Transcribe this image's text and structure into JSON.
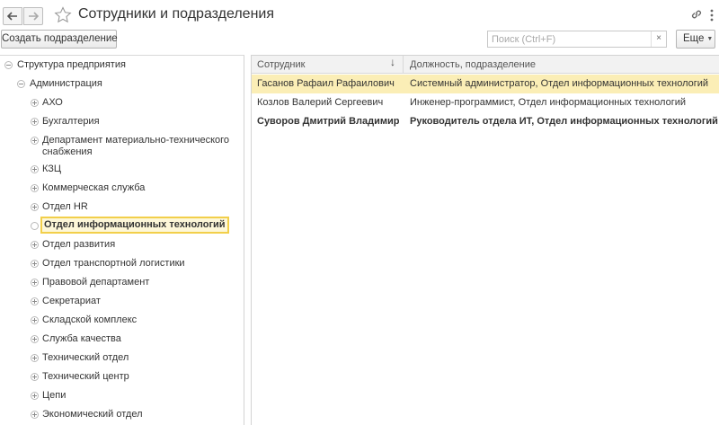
{
  "window": {
    "title": "Сотрудники и подразделения"
  },
  "toolbar": {
    "create_label": "Создать подразделение",
    "search_placeholder": "Поиск (Ctrl+F)",
    "search_value": "",
    "clear_label": "×",
    "more_label": "Еще"
  },
  "tree": {
    "root_label": "Структура предприятия",
    "admin_label": "Администрация",
    "items": [
      {
        "label": "АХО"
      },
      {
        "label": "Бухгалтерия"
      },
      {
        "label": "Департамент материально-технического снабжения"
      },
      {
        "label": "КЗЦ"
      },
      {
        "label": "Коммерческая служба"
      },
      {
        "label": "Отдел HR"
      },
      {
        "label": "Отдел информационных технологий",
        "selected": true
      },
      {
        "label": "Отдел развития"
      },
      {
        "label": "Отдел транспортной логистики"
      },
      {
        "label": "Правовой департамент"
      },
      {
        "label": "Секретариат"
      },
      {
        "label": "Складской комплекс"
      },
      {
        "label": "Служба качества"
      },
      {
        "label": "Технический отдел"
      },
      {
        "label": "Технический центр"
      },
      {
        "label": "Цепи"
      },
      {
        "label": "Экономический отдел"
      }
    ]
  },
  "table": {
    "columns": [
      "Сотрудник",
      "Должность, подразделение"
    ],
    "sort_indicator": "↓",
    "rows": [
      {
        "employee": "Гасанов Рафаил Рафаилович",
        "position": "Системный администратор, Отдел информационных технологий",
        "active": true
      },
      {
        "employee": "Козлов Валерий Сергеевич",
        "position": "Инженер-программист, Отдел информационных технологий"
      },
      {
        "employee": "Суворов Дмитрий Владимир...",
        "position": "Руководитель отдела ИТ, Отдел информационных технологий",
        "bold": true
      }
    ]
  },
  "colors": {
    "selection_border": "#f2cf4a",
    "active_row": "#fbeeb6"
  }
}
